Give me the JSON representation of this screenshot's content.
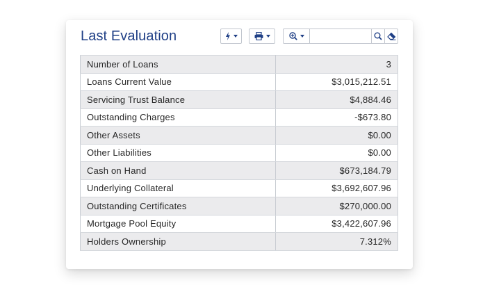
{
  "panel": {
    "title": "Last Evaluation"
  },
  "toolbar": {
    "action_icon": "lightning-bolt-icon",
    "print_icon": "printer-icon",
    "zoom_icon": "zoom-in-icon",
    "search_icon": "search-icon",
    "clear_icon": "eraser-icon",
    "search_value": "",
    "accent_color": "#1f3f86"
  },
  "rows": [
    {
      "label": "Number of Loans",
      "value": "3"
    },
    {
      "label": "Loans Current Value",
      "value": "$3,015,212.51"
    },
    {
      "label": "Servicing Trust Balance",
      "value": "$4,884.46"
    },
    {
      "label": "Outstanding Charges",
      "value": "-$673.80"
    },
    {
      "label": "Other Assets",
      "value": "$0.00"
    },
    {
      "label": "Other Liabilities",
      "value": "$0.00"
    },
    {
      "label": "Cash on Hand",
      "value": "$673,184.79"
    },
    {
      "label": "Underlying Collateral",
      "value": "$3,692,607.96"
    },
    {
      "label": "Outstanding Certificates",
      "value": "$270,000.00"
    },
    {
      "label": "Mortgage Pool Equity",
      "value": "$3,422,607.96"
    },
    {
      "label": "Holders Ownership",
      "value": "7.312%"
    }
  ]
}
